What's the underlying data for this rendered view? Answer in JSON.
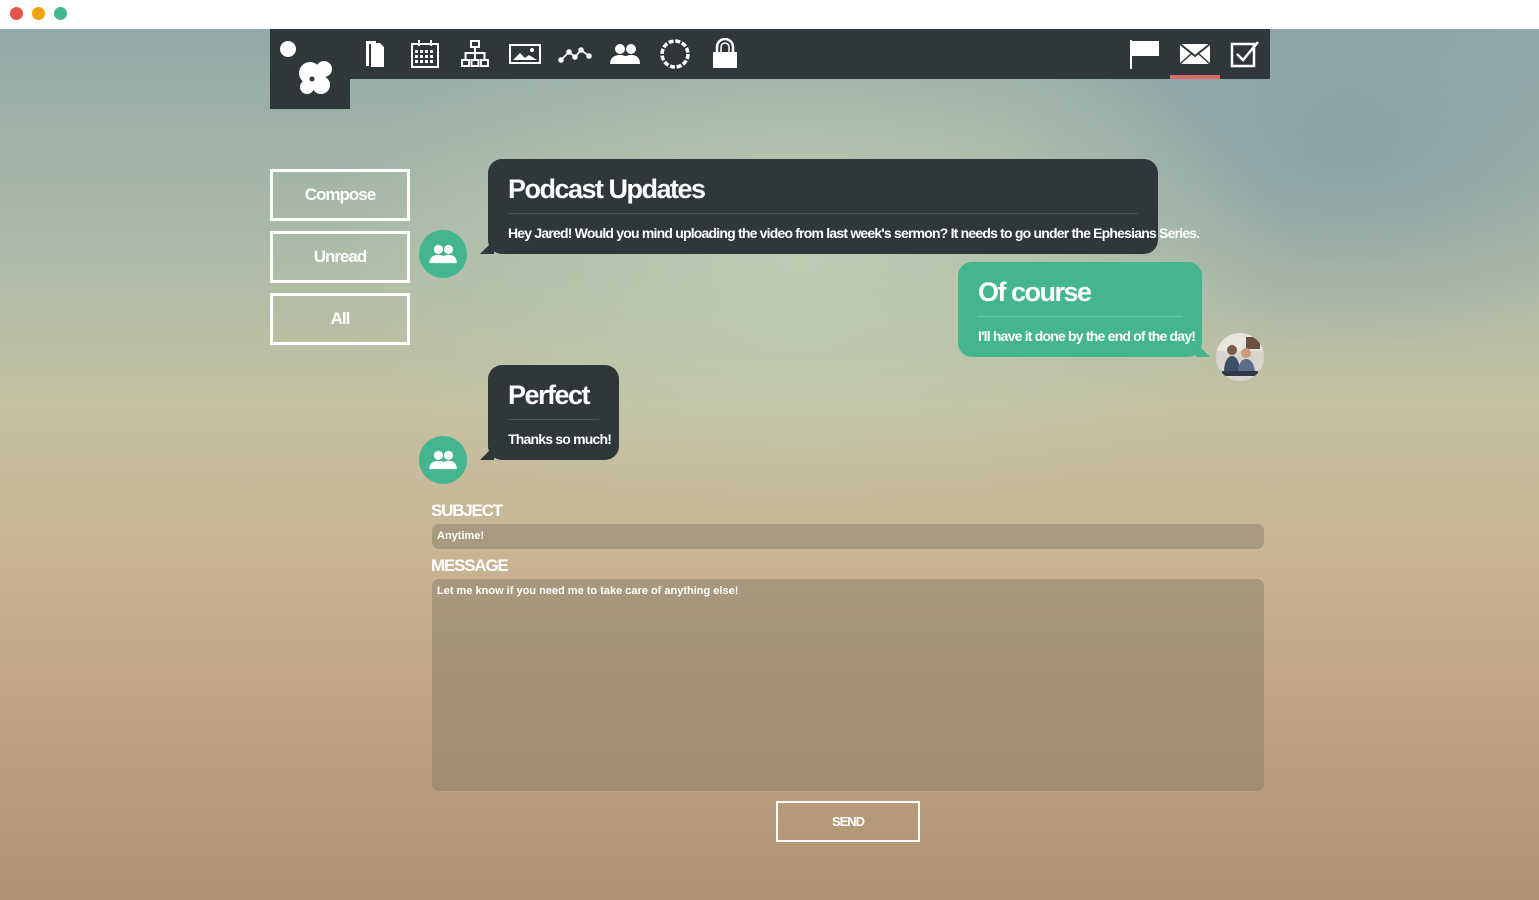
{
  "window": {
    "controls": [
      {
        "name": "close",
        "color": "#e5534b"
      },
      {
        "name": "minimize",
        "color": "#f0a30a"
      },
      {
        "name": "zoom",
        "color": "#43b58f"
      }
    ]
  },
  "navbar": {
    "icons": [
      "logo-bubbles-icon",
      "document-icon",
      "calendar-icon",
      "sitemap-icon",
      "image-icon",
      "analytics-icon",
      "users-icon",
      "settings-ring-icon",
      "lock-icon"
    ],
    "right_icons": [
      "flag-icon",
      "mail-icon",
      "checkbox-icon"
    ],
    "active": "mail-icon",
    "active_color": "#d96b6b",
    "background": "#30373b"
  },
  "sidebar": {
    "buttons": [
      {
        "label": "Compose"
      },
      {
        "label": "Unread"
      },
      {
        "label": "All"
      }
    ]
  },
  "messages": [
    {
      "title": "Podcast Updates",
      "text": "Hey Jared! Would you mind uploading the video from last week's sermon? It needs to go under the Ephesians Series.",
      "from": "group",
      "style": "dark"
    },
    {
      "title": "Of course",
      "text": "I'll have it done by the end of the day!",
      "from": "me",
      "style": "green"
    },
    {
      "title": "Perfect",
      "text": "Thanks so much!",
      "from": "group",
      "style": "dark"
    }
  ],
  "compose": {
    "subject_label": "SUBJECT",
    "subject_value": "Anytime!",
    "message_label": "MESSAGE",
    "message_value": "Let me know if you need me to take care of anything else!",
    "send_label": "SEND"
  },
  "colors": {
    "accent_green": "#43b58f",
    "dark": "#30373b"
  }
}
